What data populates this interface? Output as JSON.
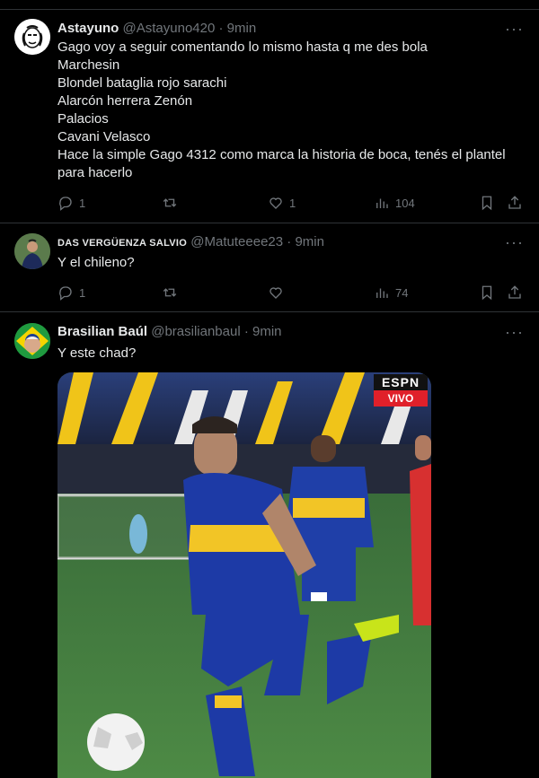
{
  "tweets": [
    {
      "name": "Astayuno",
      "handle": "@Astayuno420",
      "time": "9min",
      "lines": [
        "Gago voy a seguir comentando lo mismo hasta q me des bola",
        "Marchesin",
        "Blondel bataglia rojo sarachi",
        "Alarcón herrera Zenón",
        "Palacios",
        "Cavani Velasco",
        "Hace la simple Gago 4312 como marca la historia de boca, tenés el plantel para hacerlo"
      ],
      "replies": "1",
      "retweets": "",
      "likes": "1",
      "views": "104"
    },
    {
      "name": "DAS VERGÜENZA SALVIO",
      "handle": "@Matuteeee23",
      "time": "9min",
      "lines": [
        "Y el chileno?"
      ],
      "replies": "1",
      "retweets": "",
      "likes": "",
      "views": "74"
    },
    {
      "name": "Brasilian Baúl",
      "handle": "@brasilianbaul",
      "time": "9min",
      "lines": [
        "Y este chad?"
      ],
      "media": {
        "logo": "ESPN",
        "badge": "VIVO"
      }
    }
  ],
  "separator": "·",
  "more_label": "···",
  "colors": {
    "background": "#000000",
    "muted": "#71767b",
    "text": "#e7e9ea",
    "divider": "#2f3336",
    "vivo_red": "#e0202a"
  }
}
